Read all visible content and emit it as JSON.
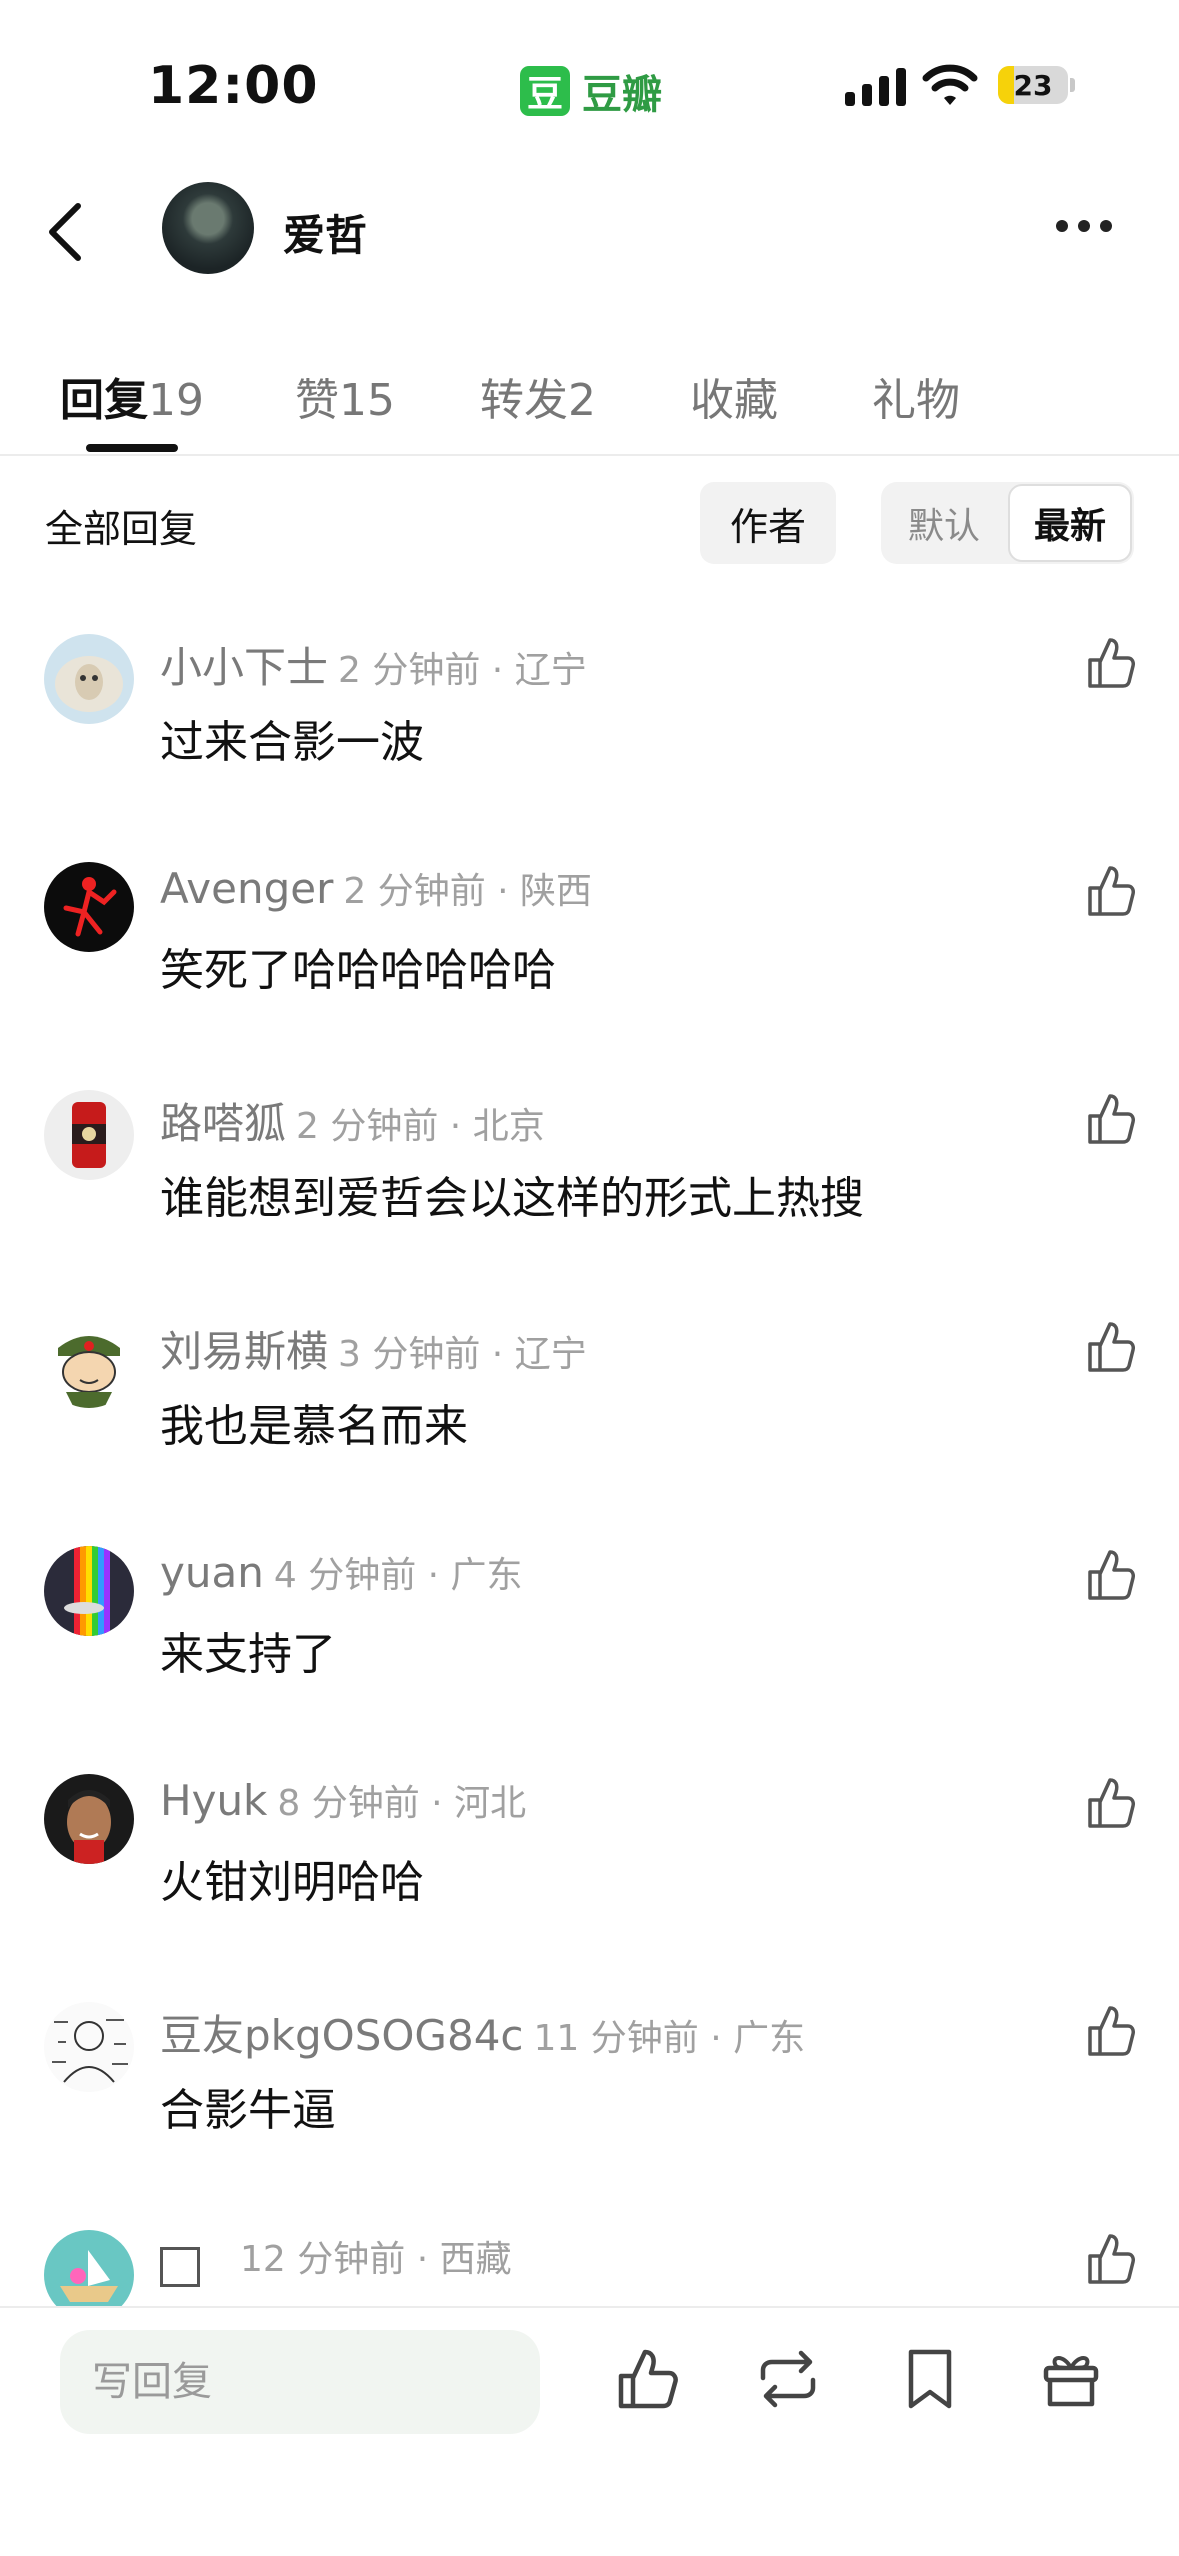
{
  "status_bar": {
    "time": "12:00",
    "app_logo_char": "豆",
    "app_name": "豆瓣",
    "battery": "23",
    "battery_level": 0.23,
    "colors": {
      "app_green": "#2dbd4b",
      "battery_yellow": "#f6d20a"
    }
  },
  "header": {
    "title": "爱哲",
    "icons": [
      "chevron-left-icon",
      "avatar",
      "more-horizontal-icon"
    ]
  },
  "tabs": [
    {
      "label": "回复",
      "count": "19",
      "active": true
    },
    {
      "label": "赞",
      "count": "15",
      "active": false
    },
    {
      "label": "转发",
      "count": "2",
      "active": false
    },
    {
      "label": "收藏",
      "count": "",
      "active": false
    },
    {
      "label": "礼物",
      "count": "",
      "active": false
    }
  ],
  "filter": {
    "label": "全部回复",
    "author_button": "作者",
    "sort_default": "默认",
    "sort_latest": "最新",
    "selected_sort": "最新"
  },
  "comments": [
    {
      "name": "小小下士",
      "time": "2 分钟前 · 辽宁",
      "text": "过来合影一波",
      "avatar": "sheep"
    },
    {
      "name": "Avenger",
      "time": "2 分钟前 · 陕西",
      "text": "笑死了哈哈哈哈哈哈",
      "avatar": "jordan"
    },
    {
      "name": "路嗒狐",
      "time": "2 分钟前 · 北京",
      "text": "谁能想到爱哲会以这样的形式上热搜",
      "avatar": "can"
    },
    {
      "name": "刘易斯横",
      "time": "3 分钟前 · 辽宁",
      "text": "我也是慕名而来",
      "avatar": "soldier"
    },
    {
      "name": "yuan",
      "time": "4 分钟前 · 广东",
      "text": "来支持了",
      "avatar": "rainbow"
    },
    {
      "name": "Hyuk",
      "time": "8 分钟前 · 河北",
      "text": "火钳刘明哈哈",
      "avatar": "player"
    },
    {
      "name": "豆友pkgOSOG84c",
      "time": "11 分钟前 · 广东",
      "text": "合影牛逼",
      "avatar": "sketch"
    },
    {
      "name": "",
      "time": "12 分钟前 · 西藏",
      "text": "",
      "avatar": "boat"
    }
  ],
  "bottom_bar": {
    "reply_placeholder": "写回复",
    "icons": [
      "like-icon",
      "repost-icon",
      "bookmark-icon",
      "gift-icon"
    ]
  }
}
